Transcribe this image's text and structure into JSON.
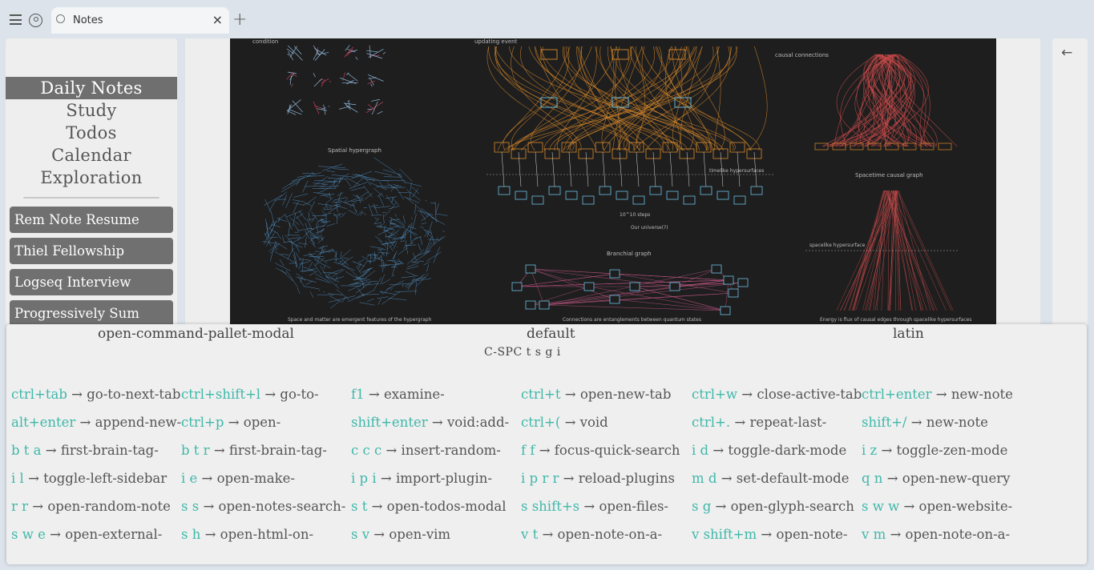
{
  "browser": {
    "tab_title": "Notes",
    "tab_close": "×",
    "new_tab": "+"
  },
  "sidebar": {
    "nav": [
      {
        "label": "Daily Notes",
        "active": true
      },
      {
        "label": "Study",
        "active": false
      },
      {
        "label": "Todos",
        "active": false
      },
      {
        "label": "Calendar",
        "active": false
      },
      {
        "label": "Exploration",
        "active": false
      }
    ],
    "notes": [
      {
        "label": "Rem Note Resume"
      },
      {
        "label": "Thiel Fellowship"
      },
      {
        "label": "Logseq Interview"
      },
      {
        "label": "Progressively Sum"
      }
    ]
  },
  "figure": {
    "captions": {
      "condition": "condition",
      "updating": "updating event",
      "causal": "causal connections",
      "spatial": "Spatial hypergraph",
      "spacetime": "Spacetime causal graph",
      "branchial": "Branchial graph",
      "timelike": "timelike hypersurfaces",
      "spacelike": "spacelike hypersurface",
      "universe": "10^10 steps",
      "universe2": "Our universe(?)",
      "foot_left": "Space and matter are emergent features of the hypergraph",
      "foot_mid": "Connections are entanglements between quantum states",
      "foot_right": "Energy is flux of causal edges through spacelike hypersurfaces"
    }
  },
  "right_panel": {
    "back": "←"
  },
  "modal": {
    "mode_name": "open-command-pallet-modal",
    "layer": "default",
    "language": "latin",
    "key_buffer": "C-SPC t s g i",
    "arrow": "→",
    "rows": [
      [
        {
          "key": "ctrl+tab",
          "action": "go-to-next-tab"
        },
        {
          "key": "ctrl+shift+l",
          "action": "go-to-"
        },
        {
          "key": "f1",
          "action": "examine-"
        },
        {
          "key": "ctrl+t",
          "action": "open-new-tab"
        },
        {
          "key": "ctrl+w",
          "action": "close-active-tab"
        },
        {
          "key": "ctrl+enter",
          "action": "new-note"
        }
      ],
      [
        {
          "key": "alt+enter",
          "action": "append-new-"
        },
        {
          "key": "ctrl+p",
          "action": "open-"
        },
        {
          "key": "shift+enter",
          "action": "void:add-"
        },
        {
          "key": "ctrl+(",
          "action": "void"
        },
        {
          "key": "ctrl+.",
          "action": "repeat-last-"
        },
        {
          "key": "shift+/",
          "action": "new-note"
        }
      ],
      [
        {
          "key": "b t a",
          "action": "first-brain-tag-"
        },
        {
          "key": "b t r",
          "action": "first-brain-tag-"
        },
        {
          "key": "c c c",
          "action": "insert-random-"
        },
        {
          "key": "f f",
          "action": "focus-quick-search"
        },
        {
          "key": "i d",
          "action": "toggle-dark-mode"
        },
        {
          "key": "i z",
          "action": "toggle-zen-mode"
        }
      ],
      [
        {
          "key": "i l",
          "action": "toggle-left-sidebar"
        },
        {
          "key": "i e",
          "action": "open-make-"
        },
        {
          "key": "i p i",
          "action": "import-plugin-"
        },
        {
          "key": "i p r r",
          "action": "reload-plugins"
        },
        {
          "key": "m d",
          "action": "set-default-mode"
        },
        {
          "key": "q n",
          "action": "open-new-query"
        }
      ],
      [
        {
          "key": "r r",
          "action": "open-random-note"
        },
        {
          "key": "s s",
          "action": "open-notes-search-"
        },
        {
          "key": "s t",
          "action": "open-todos-modal"
        },
        {
          "key": "s shift+s",
          "action": "open-files-"
        },
        {
          "key": "s g",
          "action": "open-glyph-search"
        },
        {
          "key": "s w w",
          "action": "open-website-"
        }
      ],
      [
        {
          "key": "s w e",
          "action": "open-external-"
        },
        {
          "key": "s h",
          "action": "open-html-on-"
        },
        {
          "key": "s v",
          "action": "open-vim"
        },
        {
          "key": "v t",
          "action": "open-note-on-a-"
        },
        {
          "key": "v shift+m",
          "action": "open-note-"
        },
        {
          "key": "v m",
          "action": "open-note-on-a-"
        }
      ]
    ]
  },
  "colors": {
    "key_accent": "#3fb8a9",
    "nav_active": "#6f6f6f",
    "note_bg": "#707070",
    "figure_bg": "#1e1e1e",
    "spatial_blue": "#5aa7e6",
    "causal_orange": "#d98a2b",
    "spacetime_red": "#c94a4a",
    "branchial_pink": "#b0507a"
  }
}
